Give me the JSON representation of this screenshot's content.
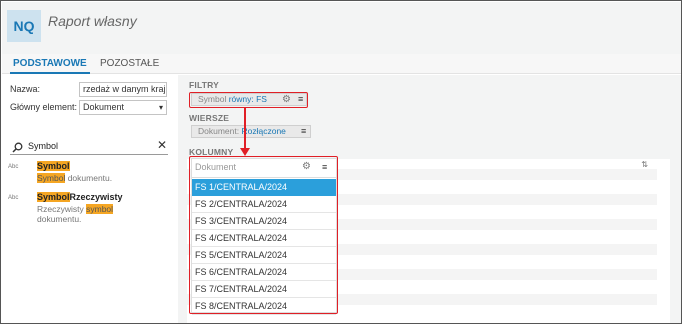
{
  "app": {
    "logo": "NQ",
    "title": "Raport własny"
  },
  "tabs": {
    "basic": "PODSTAWOWE",
    "other": "POZOSTAŁE"
  },
  "form": {
    "name_label": "Nazwa:",
    "name_value": "rzedaż w danym kraju",
    "main_label": "Główny element:",
    "main_value": "Dokument"
  },
  "search": {
    "value": "Symbol"
  },
  "results": [
    {
      "type": "Abc",
      "title_hl": "Symbol",
      "title_rest": "",
      "desc_hl": "Symbol",
      "desc_rest": " dokumentu."
    },
    {
      "type": "Abc",
      "title_hl": "Symbol",
      "title_rest": "Rzeczywisty",
      "desc_pre": "Rzeczywisty ",
      "desc_hl": "symbol",
      "desc_line2": "dokumentu."
    }
  ],
  "filters": {
    "label": "FILTRY",
    "chip_field": "Symbol",
    "chip_value": "równy: FS"
  },
  "rows_section": {
    "label": "WIERSZE",
    "chip_field": "Dokument:",
    "chip_value": "Rozłączone"
  },
  "columns": {
    "label": "KOLUMNY",
    "header": "Dokument",
    "items": [
      "FS 1/CENTRALA/2024",
      "FS 2/CENTRALA/2024",
      "FS 3/CENTRALA/2024",
      "FS 4/CENTRALA/2024",
      "FS 5/CENTRALA/2024",
      "FS 6/CENTRALA/2024",
      "FS 7/CENTRALA/2024",
      "FS 8/CENTRALA/2024"
    ],
    "selected_index": 0
  },
  "colors": {
    "accent": "#1a78b5",
    "highlight": "#f5a623",
    "selection": "#2b9fdb",
    "annotation": "#e01f26"
  }
}
